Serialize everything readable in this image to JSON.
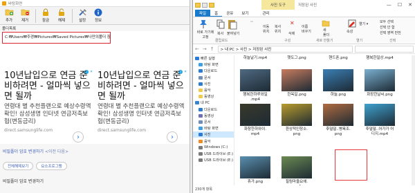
{
  "left_app": {
    "title": "바탕화면",
    "toolbar": [
      {
        "label": "추가",
        "icon": "add-folder-icon"
      },
      {
        "label": "제거",
        "icon": "remove-icon"
      },
      {
        "label": "잠금",
        "icon": "lock-icon"
      },
      {
        "label": "해제",
        "icon": "unlock-icon"
      },
      {
        "label": "설정",
        "icon": "settings-icon"
      },
      {
        "label": "정보",
        "icon": "info-icon"
      }
    ],
    "section_label": "폴더목록",
    "path_value": "C:₩Users₩주경₩Pictures₩Saved Pictures₩나만의폴더  잠금",
    "ad": {
      "left": {
        "headline": "10년납입으로 연금 준비하려면 - 얼마씩 넣으면 될까",
        "sub": "연령대 별 추천플랜으로 예상수령액 확인! 삼성생명 인터넷 연금저축보험(변동금리)",
        "url": "direct.samsunglife.com"
      },
      "right": {
        "headline": "10년납입으로 연금 준비하려면 - 얼마씩 넣으면 될까",
        "sub": "연령대 별 추천플랜으로 예상수령액 확인! 삼성생명 인터넷 연금저축보험(변동금리)",
        "url": "direct.samsunglife.com"
      },
      "arrow": "›",
      "badge": "i",
      "close": "✕"
    },
    "links": {
      "primary": "비밀폴더 암호 변경하기",
      "secondary": "<이전 다음>"
    },
    "buttons": [
      "전체해제보기",
      "요소프로그램"
    ],
    "bottom_text": "비밀폴더 암호 변경하기"
  },
  "explorer": {
    "context_tab": "사진 도구",
    "title": "저장된 사진",
    "tabs": [
      "파일",
      "홈",
      "공유",
      "보기",
      "관리"
    ],
    "ribbon": {
      "pin": "바로 가기에\n고정",
      "copy": "복사",
      "paste": "붙여넣기",
      "move": "이동\n위치",
      "copy_to": "복사\n위치",
      "delete": "삭제",
      "rename": "이름\n바꾸기",
      "new_folder": "새\n폴더",
      "properties": "속성",
      "open": "열기 ▾",
      "select_all": "모두 선택",
      "select_none": "선택 안 함",
      "invert": "선택 영역 반전",
      "group_clipboard": "클립보드",
      "group_organize": "구성",
      "group_new": "새로 만들기",
      "group_open": "열기",
      "group_select": "선택"
    },
    "address": "> 내 PC > 사진 > 저장된 사진",
    "tree": [
      {
        "label": "빠른 실행",
        "color": "#2a7bd6"
      },
      {
        "label": "바탕 화면",
        "color": "#3aa0e8"
      },
      {
        "label": "다운로드",
        "color": "#2a7bd6"
      },
      {
        "label": "문서",
        "color": "#6f8fb8"
      },
      {
        "label": "사진",
        "color": "#2a7bd6"
      },
      {
        "label": "음악",
        "color": "#f2c94c"
      },
      {
        "label": "동영상",
        "color": "#f2c94c"
      },
      {
        "label": "내 PC",
        "color": "#3a82c9"
      },
      {
        "label": "다운로드",
        "color": "#2a7bd6"
      },
      {
        "label": "동영상",
        "color": "#6f6fb8"
      },
      {
        "label": "문서",
        "color": "#6f8fb8"
      },
      {
        "label": "바탕 화면",
        "color": "#3aa0e8"
      },
      {
        "label": "사진",
        "color": "#2a7bd6"
      },
      {
        "label": "음악",
        "color": "#f08a24"
      },
      {
        "label": "Windows (C:)",
        "color": "#7a7a7a"
      },
      {
        "label": "USB 드라이브 (E:)",
        "color": "#7a7a7a"
      },
      {
        "label": "USB 드라이브 (E:)",
        "color": "#7a7a7a"
      }
    ],
    "selected_tree_index": 12,
    "files_row0": [
      "하늘날기.mp4",
      "햇도그.png",
      "핸드폰.png",
      "행복한일상.mp4"
    ],
    "files": [
      {
        "label": "행복한하루와일\n.mp4",
        "color": "#4f6a82"
      },
      {
        "label": "한옥일.png",
        "color": "#c87c5f"
      },
      {
        "label": "하늘.png",
        "color": "#3b7fb5"
      },
      {
        "label": "화장한날씨.png",
        "color": "#7ab0d0"
      },
      {
        "label": "화창한하와이.\nmp4",
        "color": "#3a3a2a"
      },
      {
        "label": "환상적인장소.\npng",
        "color": "#b99c2c"
      },
      {
        "label": "후덜덜..병욕조.\npng",
        "color": "#b06c40"
      },
      {
        "label": "후덜덜..어가가 어\n디지.mp4",
        "color": "#3fa2cf"
      },
      {
        "label": "휴가.png",
        "color": "#5a8fb0"
      },
      {
        "label": "힐링마을요에.\nmp4",
        "color": "#6b8a52"
      }
    ],
    "status": "230개 항목"
  }
}
